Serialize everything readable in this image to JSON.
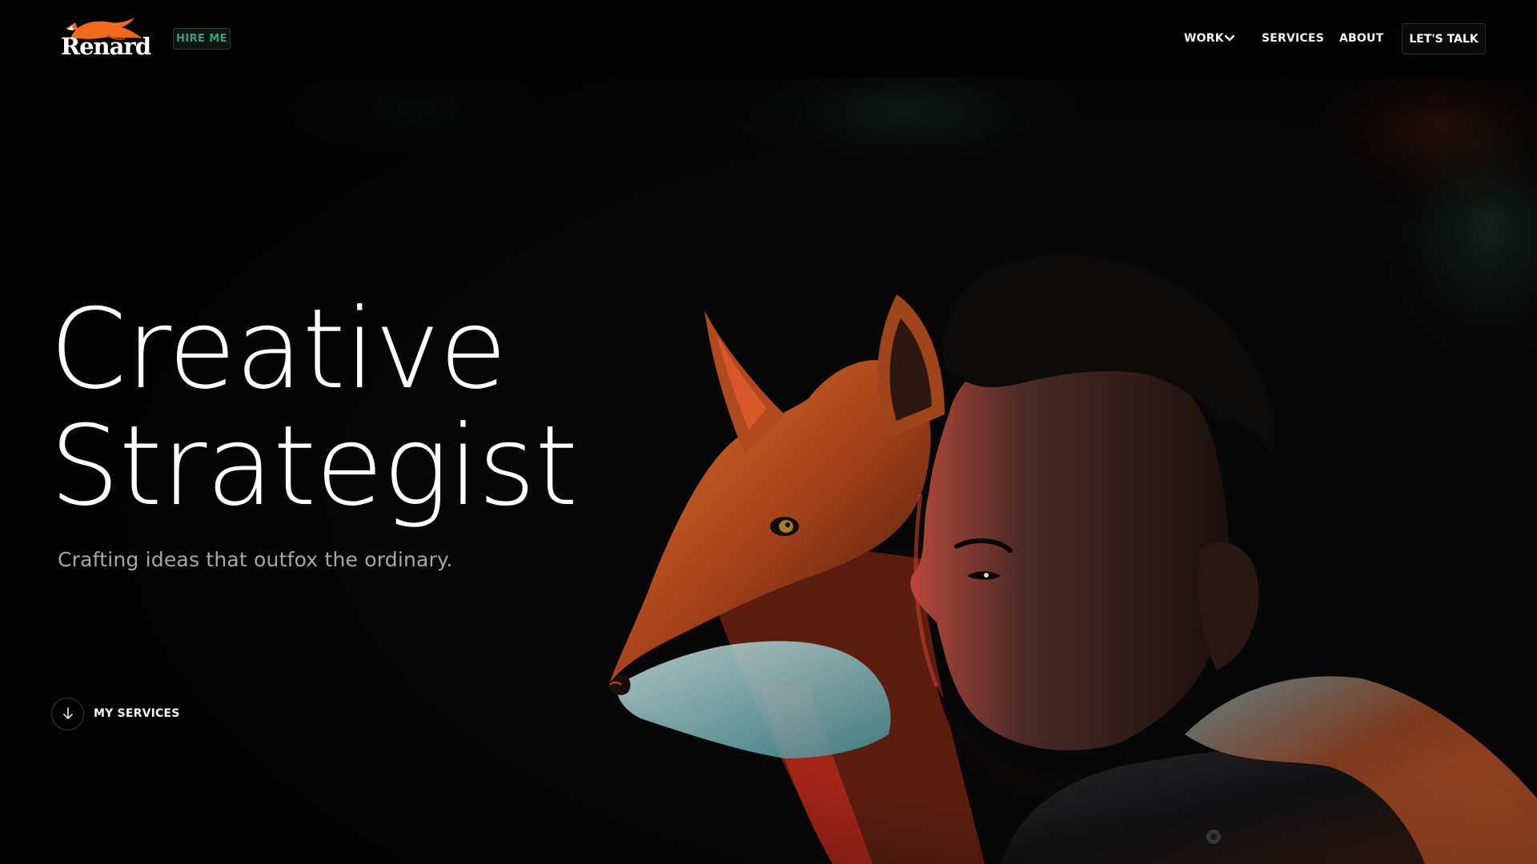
{
  "brand": {
    "name": "Renard",
    "hire_label": "HIRE ME",
    "accent_color": "#f26a1b"
  },
  "nav": {
    "items": [
      {
        "label": "WORK",
        "has_dropdown": true
      },
      {
        "label": "SERVICES"
      },
      {
        "label": "ABOUT"
      }
    ],
    "cta_label": "LET'S TALK"
  },
  "hero": {
    "headline_line1": "Creative",
    "headline_line2": "Strategist",
    "tagline": "Crafting ideas that outfox the ordinary.",
    "scroll_label": "MY SERVICES",
    "image_subject": "fox-and-man-portrait"
  },
  "icons": {
    "logo": "fox-logo-icon",
    "dropdown": "chevron-down-icon",
    "scroll": "arrow-down-icon"
  }
}
